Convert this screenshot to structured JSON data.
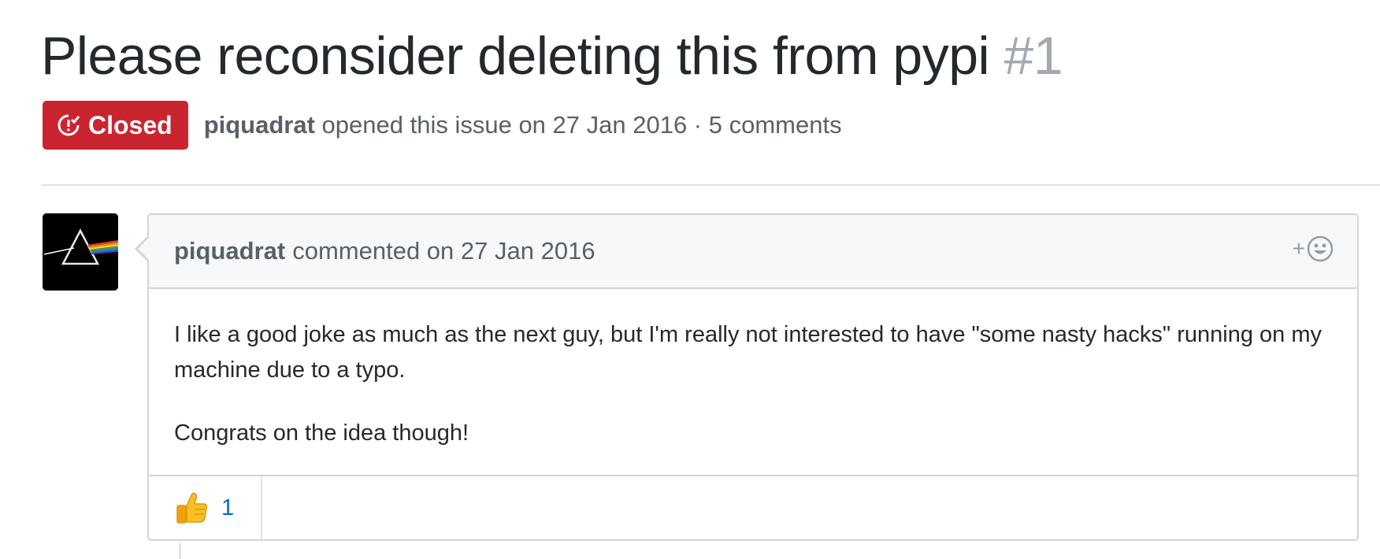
{
  "issue": {
    "title": "Please reconsider deleting this from pypi",
    "number": "#1",
    "state": "Closed",
    "state_color": "#cb2431",
    "opened_by": "piquadrat",
    "opened_text": "opened this issue on 27 Jan 2016 · 5 comments"
  },
  "comment": {
    "author": "piquadrat",
    "action": "commented on 27 Jan 2016",
    "avatar_icon": "prism-avatar-icon",
    "body": [
      "I like a good joke as much as the next guy, but I'm really not interested to have \"some nasty hacks\" running on my machine due to a typo.",
      "Congrats on the idea though!"
    ],
    "add_reaction_icon": "smiley-icon",
    "reactions": [
      {
        "icon": "thumbs-up-icon",
        "count": "1"
      }
    ]
  },
  "colors": {
    "link": "#0366d6",
    "muted": "#586069",
    "border": "#d1d5da"
  }
}
